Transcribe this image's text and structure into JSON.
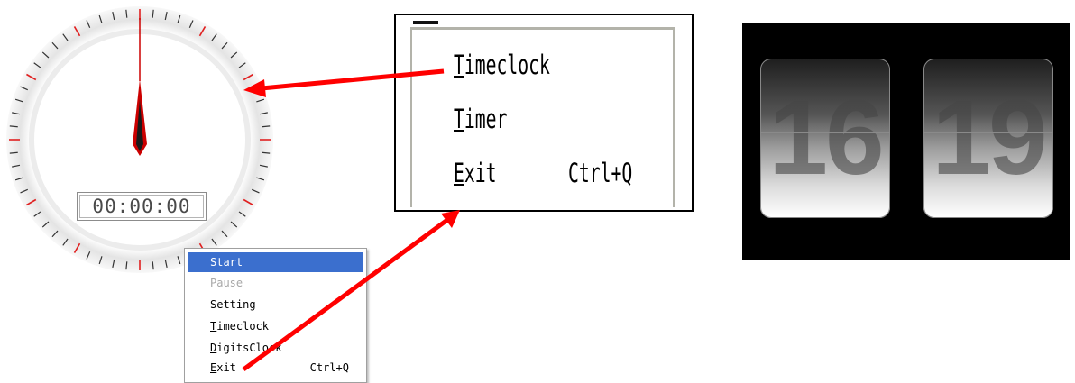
{
  "stopwatch": {
    "display": "00:00:00",
    "tick_color_major": "#e02020",
    "tick_color_minor": "#333333",
    "hand_color": "#cc0000"
  },
  "context_menu": {
    "items": [
      {
        "label": "Start",
        "mnemonic": "",
        "shortcut": "",
        "state": "selected"
      },
      {
        "label": "Pause",
        "mnemonic": "",
        "shortcut": "",
        "state": "disabled"
      },
      {
        "label": "Setting",
        "mnemonic": "",
        "shortcut": "",
        "state": "normal"
      },
      {
        "label": "Timeclock",
        "mnemonic": "T",
        "shortcut": "",
        "state": "normal"
      },
      {
        "label": "DigitsClock",
        "mnemonic": "D",
        "shortcut": "",
        "state": "normal"
      },
      {
        "label": "Exit",
        "mnemonic": "E",
        "shortcut": "Ctrl+Q",
        "state": "normal"
      }
    ],
    "highlight_color": "#3b6fce"
  },
  "zoomed_menu": {
    "items": [
      {
        "label": "Timeclock",
        "mnemonic": "T"
      },
      {
        "label": "Timer",
        "mnemonic": "T"
      },
      {
        "label": "Exit",
        "mnemonic": "E",
        "shortcut": "Ctrl+Q"
      }
    ]
  },
  "flip_clock": {
    "hours": "16",
    "minutes": "19"
  },
  "annotation_color": "#ff0000"
}
